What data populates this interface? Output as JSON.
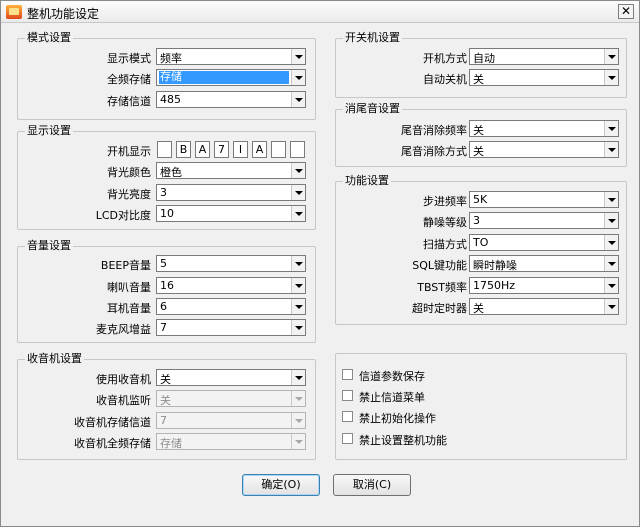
{
  "window": {
    "title": "整机功能设定",
    "close_glyph": "✕"
  },
  "mode": {
    "legend": "模式设置",
    "display_mode": {
      "label": "显示模式",
      "value": "频率"
    },
    "full_band_store": {
      "label": "全频存储",
      "value": "存储"
    },
    "store_channel": {
      "label": "存储信道",
      "value": "485"
    }
  },
  "display": {
    "legend": "显示设置",
    "boot_display": {
      "label": "开机显示",
      "chars": [
        "",
        "B",
        "A",
        "7",
        "I",
        "A",
        "",
        ""
      ]
    },
    "backlight_color": {
      "label": "背光颜色",
      "value": "橙色"
    },
    "backlight_brightness": {
      "label": "背光亮度",
      "value": "3"
    },
    "lcd_contrast": {
      "label": "LCD对比度",
      "value": "10"
    }
  },
  "volume": {
    "legend": "音量设置",
    "beep": {
      "label": "BEEP音量",
      "value": "5"
    },
    "speaker": {
      "label": "喇叭音量",
      "value": "16"
    },
    "earphone": {
      "label": "耳机音量",
      "value": "6"
    },
    "mic_gain": {
      "label": "麦克风增益",
      "value": "7"
    }
  },
  "radio": {
    "legend": "收音机设置",
    "use_radio": {
      "label": "使用收音机",
      "value": "关"
    },
    "radio_monitor": {
      "label": "收音机监听",
      "value": "关"
    },
    "radio_store_channel": {
      "label": "收音机存储信道",
      "value": "7"
    },
    "radio_full_band": {
      "label": "收音机全频存储",
      "value": "存储"
    }
  },
  "power": {
    "legend": "开关机设置",
    "boot_mode": {
      "label": "开机方式",
      "value": "自动"
    },
    "auto_off": {
      "label": "自动关机",
      "value": "关"
    }
  },
  "tail": {
    "legend": "消尾音设置",
    "tail_freq": {
      "label": "尾音消除频率",
      "value": "关"
    },
    "tail_mode": {
      "label": "尾音消除方式",
      "value": "关"
    }
  },
  "function": {
    "legend": "功能设置",
    "step": {
      "label": "步进频率",
      "value": "5K"
    },
    "squelch": {
      "label": "静噪等级",
      "value": "3"
    },
    "scan": {
      "label": "扫描方式",
      "value": "TO"
    },
    "sql_key": {
      "label": "SQL键功能",
      "value": "瞬时静噪"
    },
    "tbst": {
      "label": "TBST频率",
      "value": "1750Hz"
    },
    "tot": {
      "label": "超时定时器",
      "value": "关"
    }
  },
  "options": {
    "save_channel_params": "信道参数保存",
    "disable_channel_menu": "禁止信道菜单",
    "disable_init": "禁止初始化操作",
    "disable_device_settings": "禁止设置整机功能"
  },
  "buttons": {
    "ok": "确定(O)",
    "cancel": "取消(C)"
  }
}
